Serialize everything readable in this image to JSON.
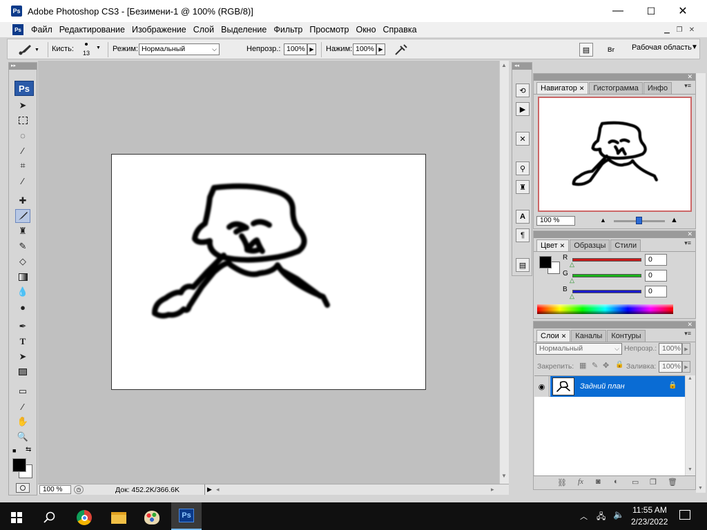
{
  "window": {
    "title": "Adobe Photoshop CS3 - [Безимени-1 @ 100% (RGB/8)]",
    "app_icon": "Ps",
    "minimize_glyph": "—",
    "maximize_glyph": "☐",
    "close_glyph": "✕"
  },
  "menu": [
    "Файл",
    "Редактирование",
    "Изображение",
    "Слой",
    "Выделение",
    "Фильтр",
    "Просмотр",
    "Окно",
    "Справка"
  ],
  "options": {
    "brush_label": "Кисть:",
    "brush_size": "13",
    "mode_label": "Режим:",
    "mode_value": "Нормальный",
    "opacity_label": "Непрозр.:",
    "opacity_value": "100%",
    "flow_label": "Нажим:",
    "flow_value": "100%",
    "workspace_label": "Рабочая область"
  },
  "toolbox": {
    "logo": "Ps"
  },
  "status": {
    "zoom": "100 %",
    "doc_info": "Док: 452.2K/366.6K"
  },
  "navigator": {
    "tabs": [
      "Навигатор",
      "Гистограмма",
      "Инфо"
    ],
    "zoom_value": "100 %"
  },
  "color": {
    "tabs": [
      "Цвет",
      "Образцы",
      "Стили"
    ],
    "channels": [
      {
        "label": "R",
        "value": "0",
        "color": "#cc1a1a"
      },
      {
        "label": "G",
        "value": "0",
        "color": "#1ab31a"
      },
      {
        "label": "B",
        "value": "0",
        "color": "#1a1acc"
      }
    ]
  },
  "layers": {
    "tabs": [
      "Слои",
      "Каналы",
      "Контуры"
    ],
    "blend_mode": "Нормальный",
    "opacity_label": "Непрозр.:",
    "opacity_value": "100%",
    "lock_label": "Закрепить:",
    "fill_label": "Заливка:",
    "fill_value": "100%",
    "items": [
      {
        "name": "Задний план"
      }
    ]
  },
  "taskbar": {
    "time": "11:55 AM",
    "date": "2/23/2022",
    "ps_label": "Ps"
  },
  "colors": {
    "accent": "#0a6cd4",
    "navigator_frame": "#cc6666"
  }
}
